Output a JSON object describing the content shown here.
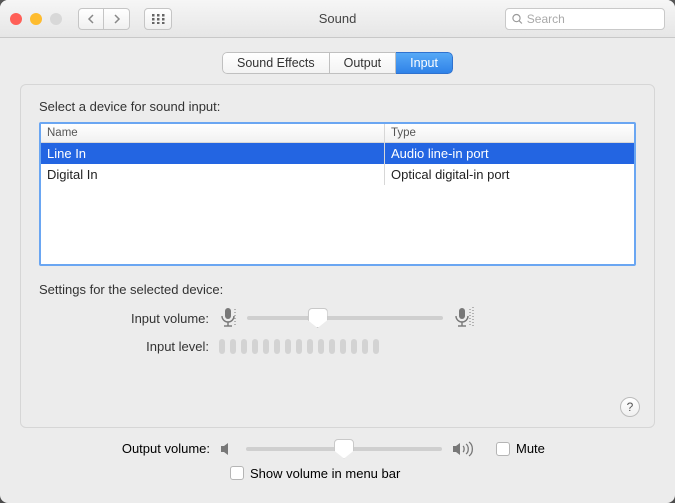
{
  "window": {
    "title": "Sound",
    "search_placeholder": "Search"
  },
  "tabs": [
    {
      "label": "Sound Effects",
      "active": false
    },
    {
      "label": "Output",
      "active": false
    },
    {
      "label": "Input",
      "active": true
    }
  ],
  "section_select_label": "Select a device for sound input:",
  "table": {
    "col_name": "Name",
    "col_type": "Type",
    "rows": [
      {
        "name": "Line In",
        "type": "Audio line-in port",
        "selected": true
      },
      {
        "name": "Digital In",
        "type": "Optical digital-in port",
        "selected": false
      }
    ]
  },
  "settings_label": "Settings for the selected device:",
  "input_volume": {
    "label": "Input volume:",
    "percent": 36
  },
  "input_level": {
    "label": "Input level:",
    "ticks": 15
  },
  "help_label": "?",
  "output_volume": {
    "label": "Output volume:",
    "percent": 50
  },
  "mute": {
    "label": "Mute",
    "checked": false
  },
  "show_menu": {
    "label": "Show volume in menu bar",
    "checked": false
  }
}
